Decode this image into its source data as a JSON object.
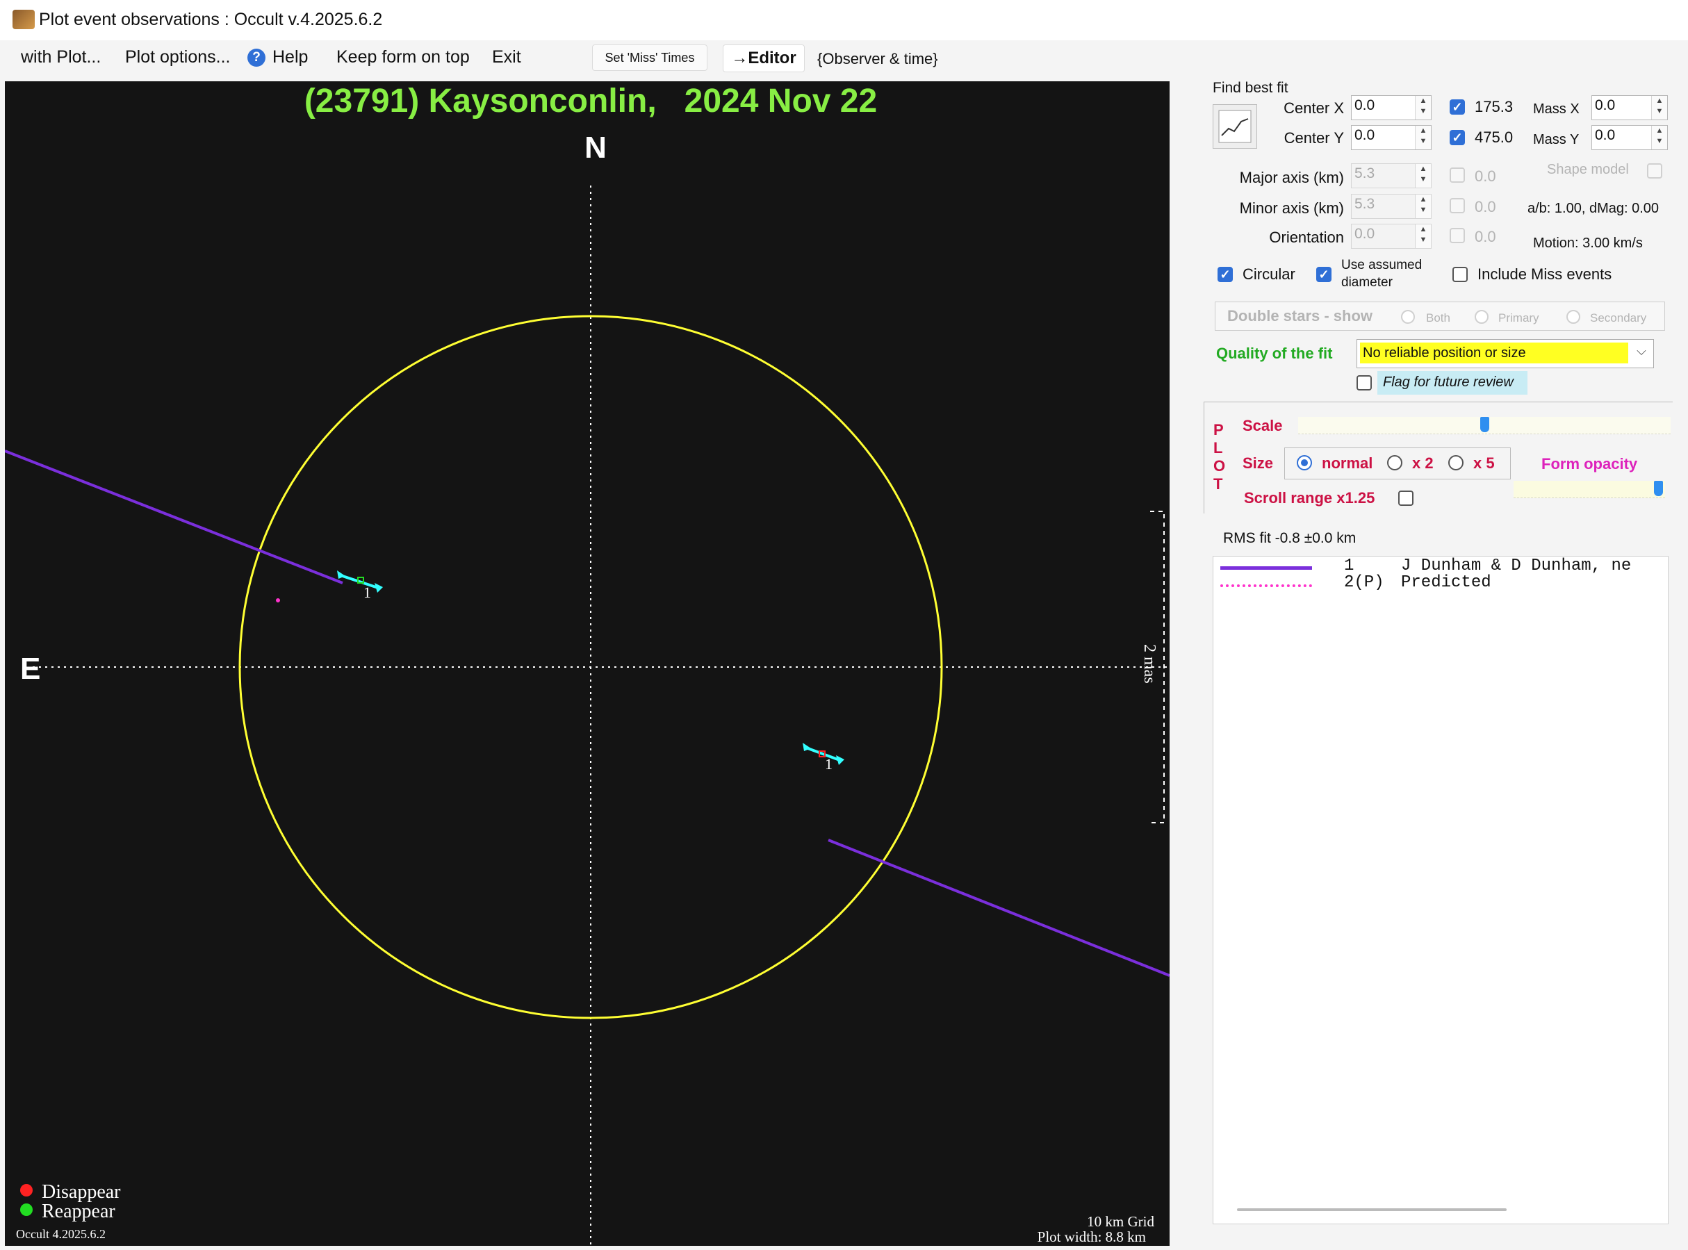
{
  "window": {
    "title": "Plot event observations : Occult v.4.2025.6.2",
    "icon": "occult-app-icon"
  },
  "menu": {
    "items": [
      "with Plot...",
      "Plot options...",
      "Help",
      "Keep form on top",
      "Exit"
    ],
    "set_miss_times": "Set 'Miss' Times",
    "editor": "→Editor",
    "observer_time": "{Observer & time}"
  },
  "plot": {
    "title": "(23791) Kaysonconlin,   2024 Nov 22",
    "north_label": "N",
    "east_label": "E",
    "scale_label": "2 mas",
    "legend": [
      {
        "label": "Disappear",
        "color": "#ff2222"
      },
      {
        "label": "Reappear",
        "color": "#22dd22"
      }
    ],
    "version_text": "Occult 4.2025.6.2",
    "grid_text": "10 km Grid",
    "plot_width_text": "Plot width: 8.8 km",
    "colors": {
      "background": "#141414",
      "ellipse": "#ffff33",
      "chord": "#7b2fdc",
      "title": "#88ee44",
      "marker": "#33ffff",
      "predicted": "#ff33cc"
    },
    "chords": [
      {
        "label": "1"
      },
      {
        "label": "1"
      }
    ]
  },
  "panel": {
    "find_best_fit": "Find best fit",
    "center_x": {
      "label": "Center X",
      "value": "0.0"
    },
    "center_y": {
      "label": "Center Y",
      "value": "0.0"
    },
    "fit_x": {
      "checked": true,
      "value": "175.3"
    },
    "fit_y": {
      "checked": true,
      "value": "475.0"
    },
    "mass_x": {
      "label": "Mass X",
      "value": "0.0"
    },
    "mass_y": {
      "label": "Mass Y",
      "value": "0.0"
    },
    "major_axis": {
      "label": "Major axis (km)",
      "value": "5.3",
      "fit_value": "0.0"
    },
    "minor_axis": {
      "label": "Minor axis (km)",
      "value": "5.3",
      "fit_value": "0.0"
    },
    "orientation": {
      "label": "Orientation",
      "value": "0.0",
      "fit_value": "0.0"
    },
    "shape_model": "Shape model",
    "ab_dmag": "a/b: 1.00, dMag: 0.00",
    "motion": "Motion: 3.00 km/s",
    "circular": {
      "label": "Circular",
      "checked": true
    },
    "use_assumed_diameter": {
      "label_line1": "Use assumed",
      "label_line2": "diameter",
      "checked": true
    },
    "include_miss": {
      "label": "Include Miss events",
      "checked": false
    },
    "double_stars": {
      "label": "Double stars - show",
      "options": [
        "Both",
        "Primary",
        "Secondary"
      ]
    },
    "quality_label": "Quality of the fit",
    "quality_value": "No reliable position or size",
    "flag_review": {
      "label": "Flag for future review",
      "checked": false
    },
    "plot_letters": [
      "P",
      "L",
      "O",
      "T"
    ],
    "scale_label": "Scale",
    "scale_level": 0.5,
    "size_label": "Size",
    "size_options": [
      "normal",
      "x 2",
      "x 5"
    ],
    "size_selected": "normal",
    "form_opacity": "Form opacity",
    "opacity_level": 1.0,
    "scroll_range": {
      "label": "Scroll range x1.25",
      "checked": false
    },
    "rms_fit": "RMS fit -0.8 ±0.0 km",
    "observers": [
      {
        "num": "1",
        "name": "J Dunham & D Dunham, ne",
        "line_style": "solid",
        "color": "#7b2fdc"
      },
      {
        "num": "2(P)",
        "name": "Predicted",
        "line_style": "dotted",
        "color": "#ff33cc"
      }
    ]
  }
}
